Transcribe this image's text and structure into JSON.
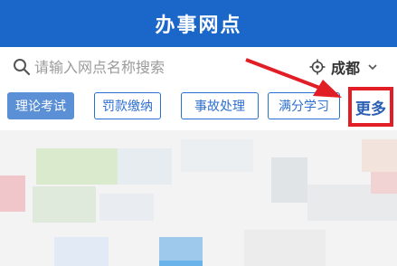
{
  "header": {
    "title": "办事网点"
  },
  "search": {
    "placeholder": "请输入网点名称搜索",
    "value": ""
  },
  "location": {
    "city": "成都"
  },
  "tabs": [
    {
      "label": "理论考试",
      "active": true
    },
    {
      "label": "罚款缴纳",
      "active": false
    },
    {
      "label": "事故处理",
      "active": false
    },
    {
      "label": "满分学习",
      "active": false
    }
  ],
  "more": {
    "label": "更多"
  },
  "colors": {
    "brand": "#1b66c9",
    "accent": "#2d6fd0",
    "highlight": "#e11d25"
  },
  "icons": [
    "search-icon",
    "location-icon",
    "chevron-down-icon",
    "arrow-pointer"
  ]
}
